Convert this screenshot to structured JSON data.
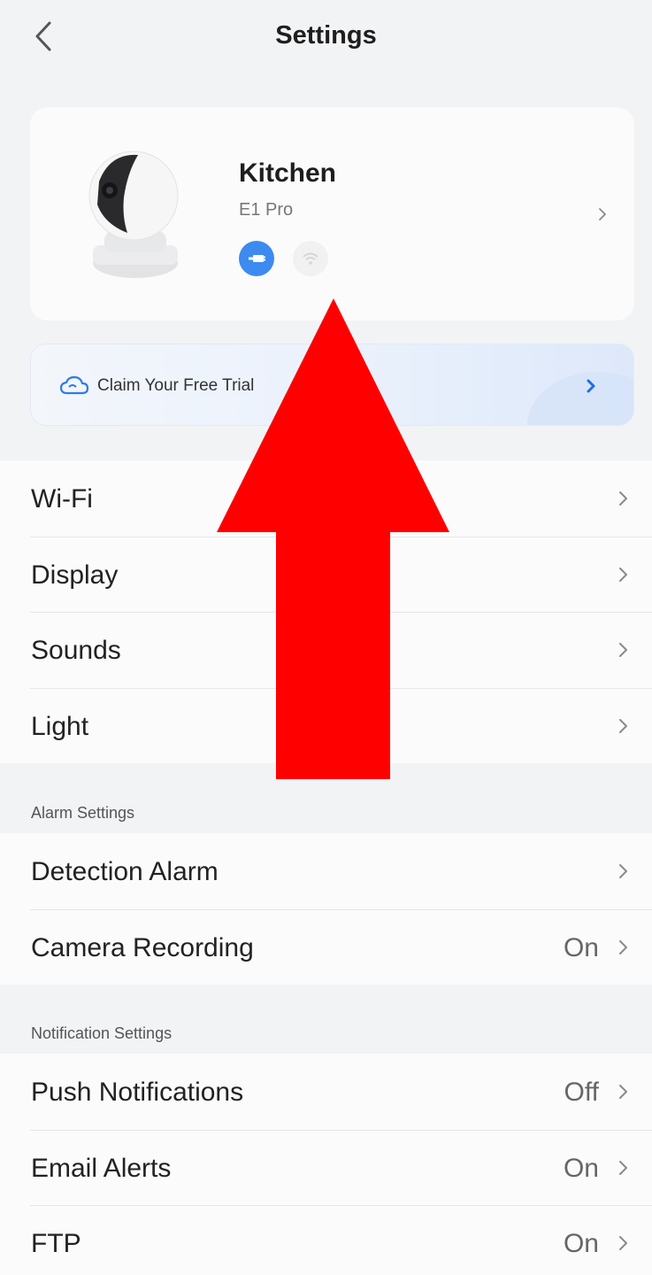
{
  "header": {
    "title": "Settings",
    "back_icon": "chevron-left-icon"
  },
  "device": {
    "name": "Kitchen",
    "model": "E1 Pro",
    "status_icons": [
      "wired-connection-icon",
      "wifi-icon"
    ],
    "accent_color": "#3d8af0"
  },
  "promo": {
    "label": "Claim Your Free Trial",
    "icon": "cloud-icon"
  },
  "general": {
    "items": [
      {
        "label": "Wi-Fi",
        "value": ""
      },
      {
        "label": "Display",
        "value": ""
      },
      {
        "label": "Sounds",
        "value": ""
      },
      {
        "label": "Light",
        "value": ""
      }
    ]
  },
  "alarm": {
    "title": "Alarm Settings",
    "items": [
      {
        "label": "Detection Alarm",
        "value": ""
      },
      {
        "label": "Camera Recording",
        "value": "On"
      }
    ]
  },
  "notification": {
    "title": "Notification Settings",
    "items": [
      {
        "label": "Push Notifications",
        "value": "Off"
      },
      {
        "label": "Email Alerts",
        "value": "On"
      },
      {
        "label": "FTP",
        "value": "On"
      }
    ]
  },
  "overlay": {
    "arrow_color": "#ff0000",
    "arrow_direction": "up"
  }
}
